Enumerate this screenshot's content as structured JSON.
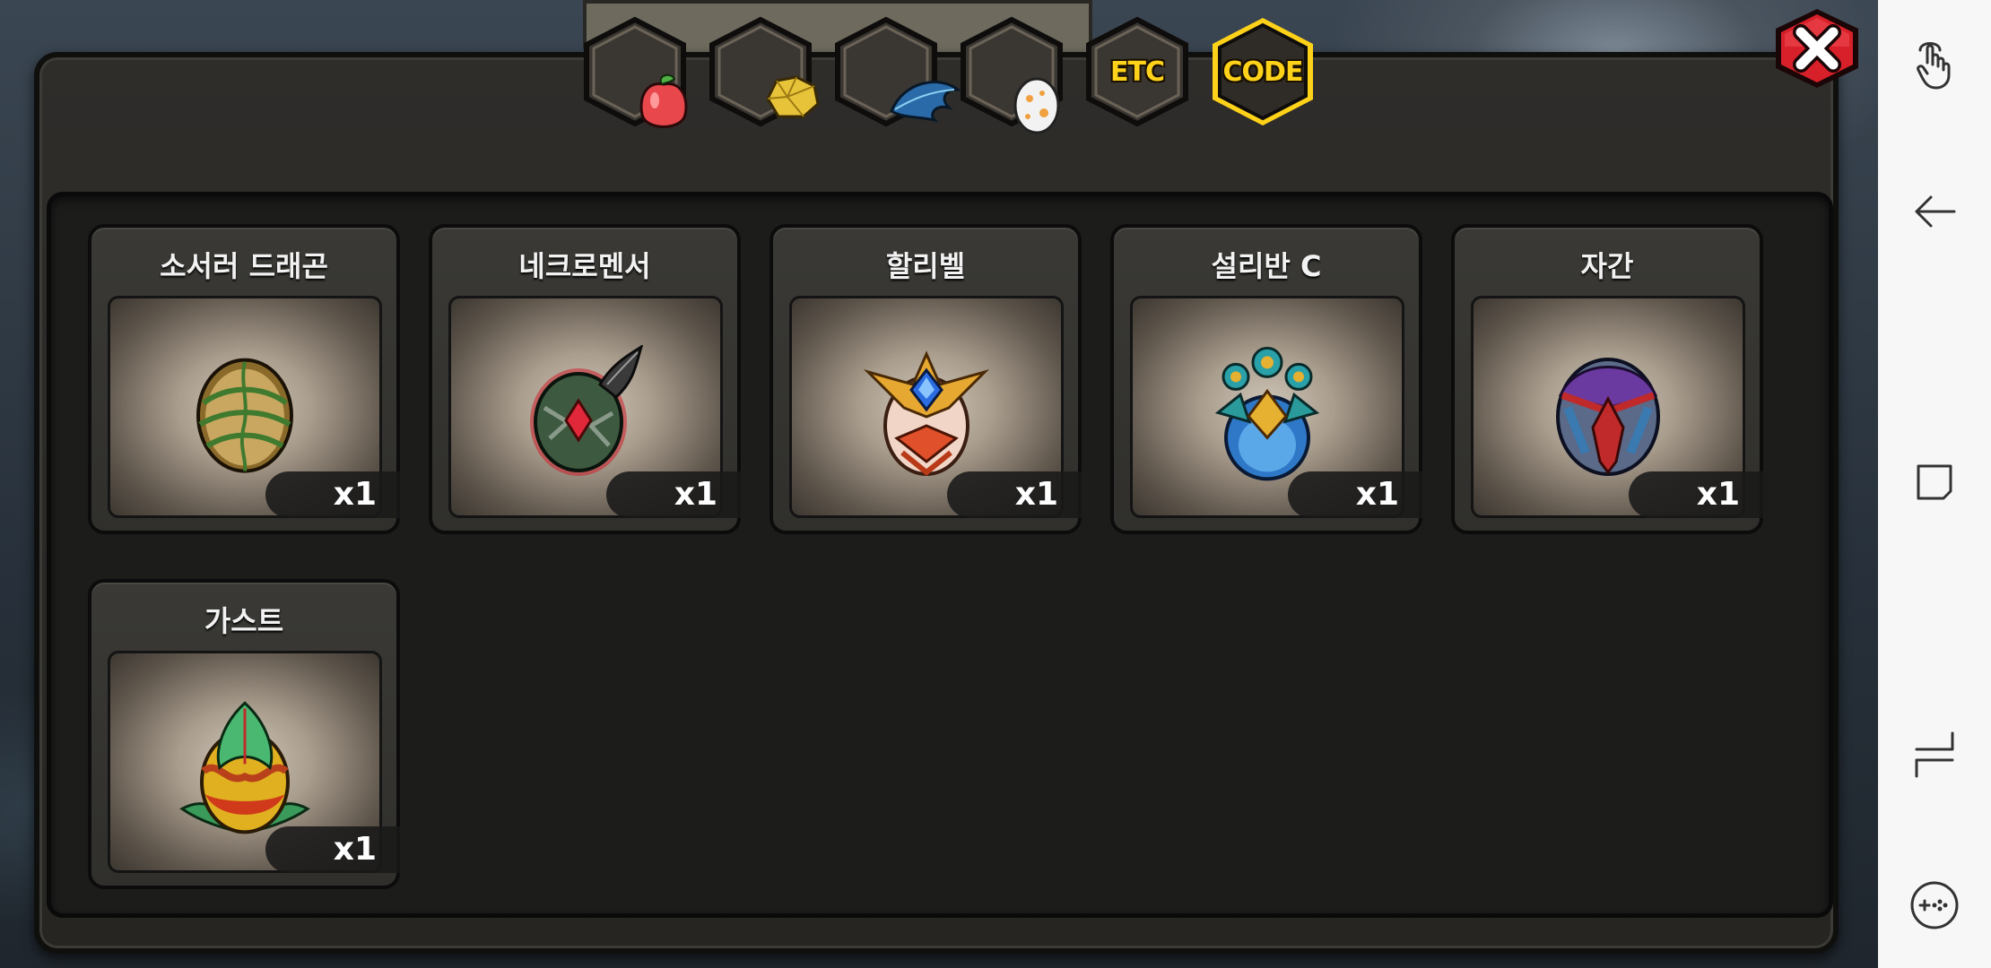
{
  "tabs": [
    {
      "name": "fruit",
      "icon": "fruit-icon",
      "label": "",
      "selected": false
    },
    {
      "name": "ore",
      "icon": "ore-icon",
      "label": "",
      "selected": false
    },
    {
      "name": "feather",
      "icon": "feather-icon",
      "label": "",
      "selected": false
    },
    {
      "name": "egg",
      "icon": "egg-icon",
      "label": "",
      "selected": false
    },
    {
      "name": "etc",
      "icon": "",
      "label": "ETC",
      "selected": false
    },
    {
      "name": "code",
      "icon": "",
      "label": "CODE",
      "selected": true
    }
  ],
  "items": [
    {
      "name": "소서러 드래곤",
      "quantity": "x1",
      "icon": "sorcerer-dragon-egg-icon",
      "colors": [
        "#8a6a2a",
        "#3f7a2e"
      ]
    },
    {
      "name": "네크로멘서",
      "quantity": "x1",
      "icon": "necromancer-egg-icon",
      "colors": [
        "#3d5a40",
        "#d02030"
      ]
    },
    {
      "name": "할리벨",
      "quantity": "x1",
      "icon": "halibel-egg-icon",
      "colors": [
        "#f1d6c8",
        "#e0502a"
      ]
    },
    {
      "name": "설리반 C",
      "quantity": "x1",
      "icon": "sullivan-c-egg-icon",
      "colors": [
        "#2f78c8",
        "#e6b030"
      ]
    },
    {
      "name": "자간",
      "quantity": "x1",
      "icon": "jagan-egg-icon",
      "colors": [
        "#6a3aa0",
        "#c02a2a"
      ]
    },
    {
      "name": "가스트",
      "quantity": "x1",
      "icon": "gast-egg-icon",
      "colors": [
        "#e0b020",
        "#3a9a5a"
      ]
    }
  ],
  "close": {
    "icon": "close-icon",
    "color": "#d8202a"
  },
  "nav_bar": {
    "buttons": [
      "touch-gesture-icon",
      "back-arrow-icon",
      "overview-square-icon",
      "switch-app-icon",
      "game-controller-icon"
    ]
  },
  "colors": {
    "selected_tab_border": "#ffd21a",
    "window_bg": "#2b2a27",
    "panel_bg": "#1c1c1b"
  }
}
